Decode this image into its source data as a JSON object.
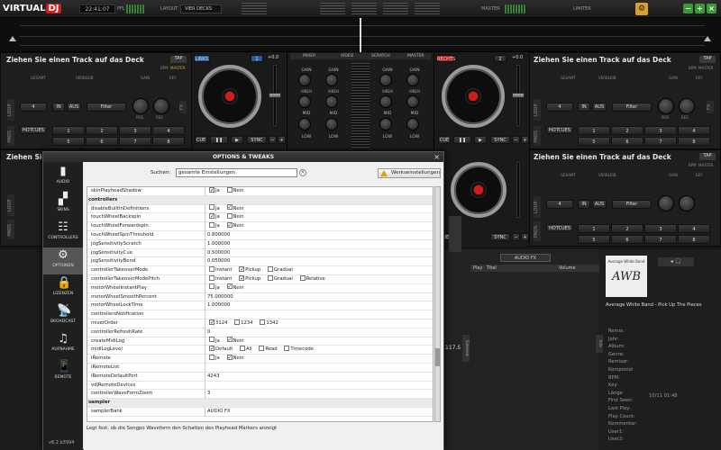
{
  "app": {
    "logo": "VIRTUAL",
    "logo_b": "DJ",
    "clock": "22:41:07",
    "pfl_label": "PFL",
    "layout_label": "LAYOUT",
    "layout_value": "VIER DECKS",
    "master_label": "MASTER",
    "limiter_label": "LIMITER"
  },
  "decks": {
    "title": "Ziehen Sie einen Track auf das Deck",
    "tap": "TAP",
    "bpm": "BPM",
    "master": "MASTER",
    "gesamt": "GESAMT",
    "verbleib": "VERBLEIB.",
    "gain": "GAIN",
    "key": "KEY",
    "loop": "LOOP",
    "pads": "PADS",
    "hotcues": "HOTCUES",
    "loop_val": "4",
    "in": "IN",
    "aus": "AUS",
    "filter": "Filter",
    "pos": "POS",
    "res": "RES",
    "fx": "FX",
    "cue": "CUE",
    "sync": "SYNC",
    "plus": "+0.0",
    "pad_nums": [
      "1",
      "2",
      "3",
      "4",
      "5",
      "6",
      "7",
      "8"
    ],
    "links": "LINKS",
    "rechts": "RECHTS",
    "deck1": "1",
    "deck2": "2",
    "deck3": "3",
    "deck4": "4",
    "cb": "CBG"
  },
  "mixer": {
    "tabs": [
      "MIXER",
      "VIDEO",
      "SCRATCH",
      "MASTER"
    ],
    "gain": "GAIN",
    "high": "HIGH",
    "mid": "MID",
    "low": "LOW"
  },
  "dialog": {
    "title": "OPTIONS & TWEAKS",
    "search_label": "Suchen:",
    "search_value": "gesamte Einstellungen",
    "reset_label": "Werkseinstellungen",
    "help": "Legt fest, ob die Songpo Waveform den Schatten des Playhead Markers anzeigt",
    "version": "v8.2 b3994",
    "sidebar": [
      {
        "label": "AUDIO",
        "icon": "▮"
      },
      {
        "label": "SKINS",
        "icon": "▞"
      },
      {
        "label": "CONTROLLERS",
        "icon": "☷"
      },
      {
        "label": "OPTIONEN",
        "icon": "⚙"
      },
      {
        "label": "LIZENZEN",
        "icon": "🔒"
      },
      {
        "label": "BROADCAST",
        "icon": "📡"
      },
      {
        "label": "AUFNAHME",
        "icon": "♫"
      },
      {
        "label": "REMOTE",
        "icon": "📱"
      }
    ],
    "rows": [
      {
        "k": "skinPlayheadShadow",
        "v": [
          {
            "c": true,
            "t": "Ja"
          },
          {
            "c": false,
            "t": "Nein"
          }
        ]
      },
      {
        "k": "controllers",
        "cat": true
      },
      {
        "k": "disableBuiltInDefinitions",
        "v": [
          {
            "c": false,
            "t": "Ja"
          },
          {
            "c": true,
            "t": "Nein"
          }
        ]
      },
      {
        "k": "touchWheelBackspin",
        "v": [
          {
            "c": true,
            "t": "Ja"
          },
          {
            "c": false,
            "t": "Nein"
          }
        ]
      },
      {
        "k": "touchWheelForwardspin",
        "v": [
          {
            "c": false,
            "t": "Ja"
          },
          {
            "c": true,
            "t": "Nein"
          }
        ]
      },
      {
        "k": "touchWheelSpinThreshold",
        "t": "0.800000"
      },
      {
        "k": "jogSensitivityScratch",
        "t": "1.000000"
      },
      {
        "k": "jogSensitivityCue",
        "t": "0.500000"
      },
      {
        "k": "jogSensitivityBend",
        "t": "0.050000"
      },
      {
        "k": "controllerTakeoverMode",
        "v": [
          {
            "c": false,
            "t": "Instant"
          },
          {
            "c": true,
            "t": "Pickup"
          },
          {
            "c": false,
            "t": "Gradual"
          }
        ]
      },
      {
        "k": "controllerTakeoverModePitch",
        "v": [
          {
            "c": false,
            "t": "Instant"
          },
          {
            "c": true,
            "t": "Pickup"
          },
          {
            "c": false,
            "t": "Gradual"
          },
          {
            "c": false,
            "t": "Relative"
          }
        ]
      },
      {
        "k": "motorWheelInstantPlay",
        "v": [
          {
            "c": false,
            "t": "Ja"
          },
          {
            "c": true,
            "t": "Nein"
          }
        ]
      },
      {
        "k": "motorWheelSmoothPercent",
        "t": "75.000000"
      },
      {
        "k": "motorWheelLockTime",
        "t": "1.000000"
      },
      {
        "k": "controllersNotification",
        "t": ""
      },
      {
        "k": "mixerOrder",
        "v": [
          {
            "c": true,
            "t": "3124"
          },
          {
            "c": false,
            "t": "1234"
          },
          {
            "c": false,
            "t": "1342"
          }
        ]
      },
      {
        "k": "controllerRefreshRate",
        "t": "0"
      },
      {
        "k": "createMidiLog",
        "v": [
          {
            "c": false,
            "t": "Ja"
          },
          {
            "c": true,
            "t": "Nein"
          }
        ]
      },
      {
        "k": "midiLogLevel",
        "v": [
          {
            "c": true,
            "t": "Default"
          },
          {
            "c": false,
            "t": "All"
          },
          {
            "c": false,
            "t": "Read"
          },
          {
            "c": false,
            "t": "Timecode"
          }
        ]
      },
      {
        "k": "iRemote",
        "v": [
          {
            "c": false,
            "t": "Ja"
          },
          {
            "c": true,
            "t": "Nein"
          }
        ]
      },
      {
        "k": "iRemoteList",
        "t": ""
      },
      {
        "k": "iRemoteDefaultPort",
        "t": "4243"
      },
      {
        "k": "vdjRemoteDevices",
        "t": ""
      },
      {
        "k": "controllerWaveFormZoom",
        "t": "3"
      },
      {
        "k": "sampler",
        "cat": true
      },
      {
        "k": "samplerBank",
        "t": "AUDIO FX"
      }
    ]
  },
  "browser": {
    "audio_fx": "AUDIO FX",
    "col_play": "Play",
    "col_titel": "Titel",
    "col_volume": "Volume",
    "bpm_big": "117.5",
    "song": "Average White Band - Pick Up The Pieces",
    "album_art_text": "AWB",
    "album_art_caption": "Average White Band",
    "info": [
      "Remix:",
      "Jahr:",
      "Album:",
      "Genre:",
      "Remixer:",
      "Komponist",
      "BPM:",
      "Key:",
      "Länge",
      "First Seen:",
      "Last Play:",
      "Play Count:",
      "Kommentar:",
      "User1:",
      "User2:"
    ],
    "first_seen": "10/11 01:48",
    "info_tab": "Info",
    "side_tab": "Sideview"
  }
}
